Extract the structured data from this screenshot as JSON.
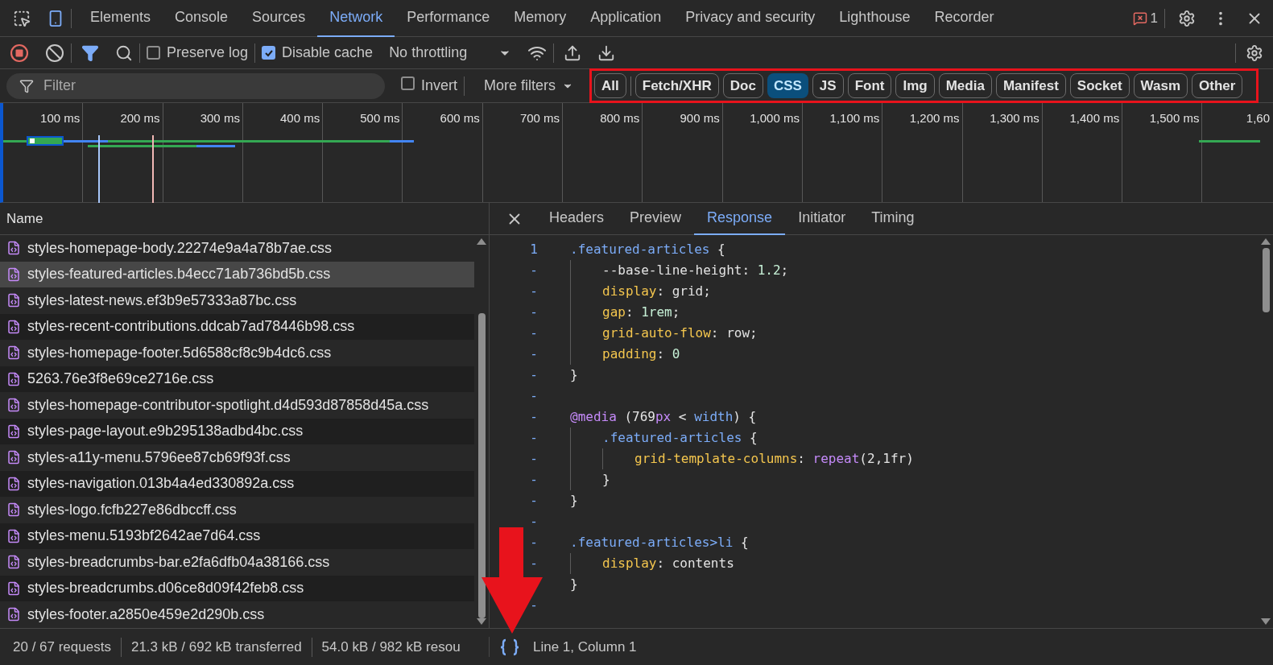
{
  "panel_tabs": [
    {
      "label": "Elements",
      "selected": false
    },
    {
      "label": "Console",
      "selected": false
    },
    {
      "label": "Sources",
      "selected": false
    },
    {
      "label": "Network",
      "selected": true
    },
    {
      "label": "Performance",
      "selected": false
    },
    {
      "label": "Memory",
      "selected": false
    },
    {
      "label": "Application",
      "selected": false
    },
    {
      "label": "Privacy and security",
      "selected": false
    },
    {
      "label": "Lighthouse",
      "selected": false
    },
    {
      "label": "Recorder",
      "selected": false
    }
  ],
  "issues_count": "1",
  "toolbar": {
    "preserve_log": {
      "label": "Preserve log",
      "checked": false
    },
    "disable_cache": {
      "label": "Disable cache",
      "checked": true
    },
    "throttling": "No throttling"
  },
  "filter_bar": {
    "placeholder": "Filter",
    "invert": {
      "label": "Invert",
      "checked": false
    },
    "more_filters": "More filters",
    "types": [
      {
        "label": "All",
        "selected": false
      },
      {
        "label": "Fetch/XHR",
        "selected": false
      },
      {
        "label": "Doc",
        "selected": false
      },
      {
        "label": "CSS",
        "selected": true
      },
      {
        "label": "JS",
        "selected": false
      },
      {
        "label": "Font",
        "selected": false
      },
      {
        "label": "Img",
        "selected": false
      },
      {
        "label": "Media",
        "selected": false
      },
      {
        "label": "Manifest",
        "selected": false
      },
      {
        "label": "Socket",
        "selected": false
      },
      {
        "label": "Wasm",
        "selected": false
      },
      {
        "label": "Other",
        "selected": false
      }
    ]
  },
  "timeline": {
    "ticks": [
      "100 ms",
      "200 ms",
      "300 ms",
      "400 ms",
      "500 ms",
      "600 ms",
      "700 ms",
      "800 ms",
      "900 ms",
      "1,000 ms",
      "1,100 ms",
      "1,200 ms",
      "1,300 ms",
      "1,400 ms",
      "1,500 ms",
      "1,60"
    ]
  },
  "request_list": {
    "column": "Name",
    "rows": [
      {
        "name": "styles-homepage-body.22274e9a4a78b7ae.css",
        "selected": false
      },
      {
        "name": "styles-featured-articles.b4ecc71ab736bd5b.css",
        "selected": true
      },
      {
        "name": "styles-latest-news.ef3b9e57333a87bc.css",
        "selected": false
      },
      {
        "name": "styles-recent-contributions.ddcab7ad78446b98.css",
        "selected": false
      },
      {
        "name": "styles-homepage-footer.5d6588cf8c9b4dc6.css",
        "selected": false
      },
      {
        "name": "5263.76e3f8e69ce2716e.css",
        "selected": false
      },
      {
        "name": "styles-homepage-contributor-spotlight.d4d593d87858d45a.css",
        "selected": false
      },
      {
        "name": "styles-page-layout.e9b295138adbd4bc.css",
        "selected": false
      },
      {
        "name": "styles-a11y-menu.5796ee87cb69f93f.css",
        "selected": false
      },
      {
        "name": "styles-navigation.013b4a4ed330892a.css",
        "selected": false
      },
      {
        "name": "styles-logo.fcfb227e86dbccff.css",
        "selected": false
      },
      {
        "name": "styles-menu.5193bf2642ae7d64.css",
        "selected": false
      },
      {
        "name": "styles-breadcrumbs-bar.e2fa6dfb04a38166.css",
        "selected": false
      },
      {
        "name": "styles-breadcrumbs.d06ce8d09f42feb8.css",
        "selected": false
      },
      {
        "name": "styles-footer.a2850e459e2d290b.css",
        "selected": false
      }
    ]
  },
  "detail_tabs": [
    {
      "label": "Headers",
      "selected": false
    },
    {
      "label": "Preview",
      "selected": false
    },
    {
      "label": "Response",
      "selected": true
    },
    {
      "label": "Initiator",
      "selected": false
    },
    {
      "label": "Timing",
      "selected": false
    }
  ],
  "code": [
    {
      "gutter": "1",
      "tokens": [
        {
          "kind": "selector",
          "text": ".featured-articles"
        },
        {
          "kind": "plain",
          "text": " {"
        }
      ],
      "children": [
        {
          "gutter": "-",
          "tokens": [
            {
              "kind": "plain",
              "text": "--base-line-height: "
            },
            {
              "kind": "number",
              "text": "1.2"
            },
            {
              "kind": "plain",
              "text": ";"
            }
          ]
        },
        {
          "gutter": "-",
          "tokens": [
            {
              "kind": "property",
              "text": "display"
            },
            {
              "kind": "plain",
              "text": ": grid;"
            }
          ]
        },
        {
          "gutter": "-",
          "tokens": [
            {
              "kind": "property",
              "text": "gap"
            },
            {
              "kind": "plain",
              "text": ": "
            },
            {
              "kind": "number",
              "text": "1rem"
            },
            {
              "kind": "plain",
              "text": ";"
            }
          ]
        },
        {
          "gutter": "-",
          "tokens": [
            {
              "kind": "property",
              "text": "grid-auto-flow"
            },
            {
              "kind": "plain",
              "text": ": row;"
            }
          ]
        },
        {
          "gutter": "-",
          "tokens": [
            {
              "kind": "property",
              "text": "padding"
            },
            {
              "kind": "plain",
              "text": ": "
            },
            {
              "kind": "number",
              "text": "0"
            }
          ]
        }
      ]
    },
    {
      "gutter": "-",
      "tokens": [
        {
          "kind": "plain",
          "text": "}"
        }
      ]
    },
    {
      "gutter": "-"
    },
    {
      "gutter": "-",
      "tokens": [
        {
          "kind": "keyword",
          "text": "@media"
        },
        {
          "kind": "plain",
          "text": " (769"
        },
        {
          "kind": "keyword",
          "text": "px"
        },
        {
          "kind": "plain",
          "text": " < "
        },
        {
          "kind": "selector",
          "text": "width"
        },
        {
          "kind": "plain",
          "text": ") {"
        }
      ],
      "children": [
        {
          "gutter": "-",
          "tokens": [
            {
              "kind": "selector",
              "text": ".featured-articles"
            },
            {
              "kind": "plain",
              "text": " {"
            }
          ],
          "children": [
            {
              "gutter": "-",
              "tokens": [
                {
                  "kind": "property",
                  "text": "grid-template-columns"
                },
                {
                  "kind": "plain",
                  "text": ": "
                },
                {
                  "kind": "keyword",
                  "text": "repeat"
                },
                {
                  "kind": "plain",
                  "text": "(2,1fr)"
                }
              ]
            }
          ]
        },
        {
          "gutter": "-",
          "tokens": [
            {
              "kind": "plain",
              "text": "}"
            }
          ]
        }
      ]
    },
    {
      "gutter": "-",
      "tokens": [
        {
          "kind": "plain",
          "text": "}"
        }
      ]
    },
    {
      "gutter": "-"
    },
    {
      "gutter": "-",
      "tokens": [
        {
          "kind": "selector",
          "text": ".featured-articles>li"
        },
        {
          "kind": "plain",
          "text": " {"
        }
      ],
      "children": [
        {
          "gutter": "-",
          "tokens": [
            {
              "kind": "property",
              "text": "display"
            },
            {
              "kind": "plain",
              "text": ": contents"
            }
          ]
        }
      ]
    },
    {
      "tokens": [
        {
          "kind": "plain",
          "text": "}"
        }
      ]
    },
    {
      "gutter": "-"
    }
  ],
  "status": {
    "requests": "20 / 67 requests",
    "transferred": "21.3 kB / 692 kB transferred",
    "resources": "54.0 kB / 982 kB resou",
    "position": "Line 1, Column 1"
  }
}
